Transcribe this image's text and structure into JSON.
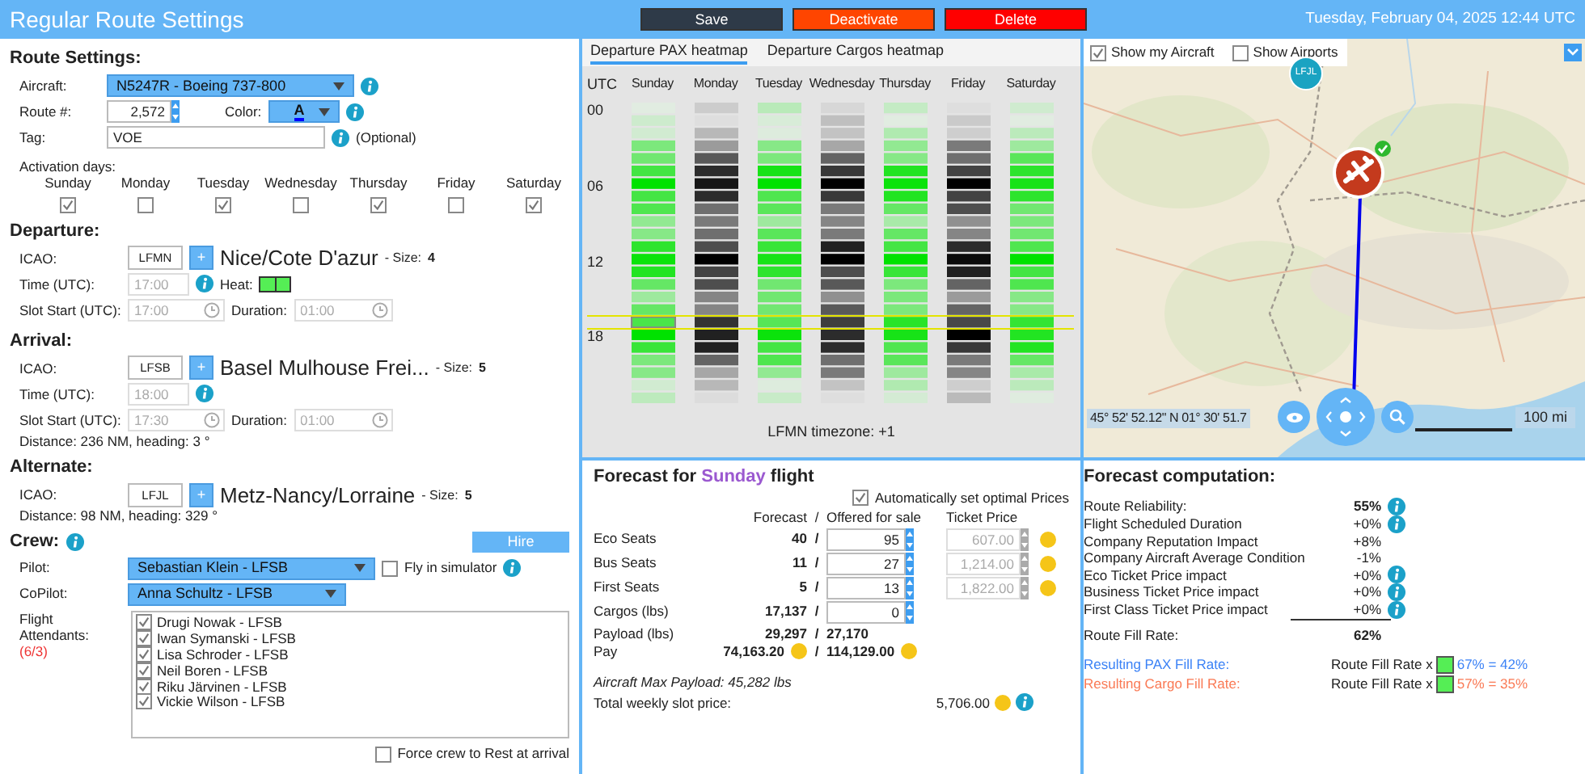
{
  "header": {
    "title": "Regular Route Settings",
    "buttons": [
      {
        "label": "Save",
        "kind": "save"
      },
      {
        "label": "Deactivate",
        "kind": "deactivate"
      },
      {
        "label": "Delete",
        "kind": "delete"
      }
    ],
    "datetime": "Tuesday, February 04, 2025 12:44 UTC"
  },
  "route_settings": {
    "heading": "Route Settings:",
    "aircraft": {
      "label": "Aircraft:",
      "value": "N5247R - Boeing 737-800"
    },
    "route_number": {
      "label": "Route #:",
      "value": "2,572"
    },
    "color": {
      "label": "Color:",
      "value": "A"
    },
    "tag": {
      "label": "Tag:",
      "value": "VOE",
      "note": "(Optional)"
    },
    "activation_days": {
      "label": "Activation days:",
      "days": [
        {
          "label": "Sunday",
          "checked": true
        },
        {
          "label": "Monday",
          "checked": false
        },
        {
          "label": "Tuesday",
          "checked": true
        },
        {
          "label": "Wednesday",
          "checked": false
        },
        {
          "label": "Thursday",
          "checked": true
        },
        {
          "label": "Friday",
          "checked": false
        },
        {
          "label": "Saturday",
          "checked": true
        }
      ]
    }
  },
  "departure": {
    "heading": "Departure:",
    "icao_label": "ICAO:",
    "icao": "LFMN",
    "add": "+",
    "airport": "Nice/Cote D'azur",
    "size_label": "- Size:",
    "size": "4",
    "time_label": "Time (UTC):",
    "time": "17:00",
    "heat_label": "Heat:",
    "slot_label": "Slot Start (UTC):",
    "slot": "17:00",
    "duration_label": "Duration:",
    "duration": "01:00"
  },
  "arrival": {
    "heading": "Arrival:",
    "icao_label": "ICAO:",
    "icao": "LFSB",
    "add": "+",
    "airport": "Basel Mulhouse Frei...",
    "size_label": "- Size:",
    "size": "5",
    "time_label": "Time (UTC):",
    "time": "18:00",
    "slot_label": "Slot Start (UTC):",
    "slot": "17:30",
    "duration_label": "Duration:",
    "duration": "01:00",
    "distance": "Distance: 236 NM, heading: 3 °"
  },
  "alternate": {
    "heading": "Alternate:",
    "icao_label": "ICAO:",
    "icao": "LFJL",
    "add": "+",
    "airport": "Metz-Nancy/Lorraine",
    "size_label": "- Size:",
    "size": "5",
    "distance": "Distance: 98 NM, heading: 329 °"
  },
  "crew": {
    "heading": "Crew:",
    "hire": "Hire",
    "pilot_label": "Pilot:",
    "pilot": "Sebastian Klein - LFSB",
    "simulator": {
      "label": "Fly in simulator",
      "checked": false
    },
    "copilot_label": "CoPilot:",
    "copilot": "Anna Schultz - LFSB",
    "attendants_label": "Flight Attendants:",
    "attendants_count": "(6/3)",
    "attendants": [
      {
        "name": "Drugi Nowak - LFSB",
        "checked": true
      },
      {
        "name": "Iwan Symanski - LFSB",
        "checked": true
      },
      {
        "name": "Lisa Schroder - LFSB",
        "checked": true
      },
      {
        "name": "Neil Boren - LFSB",
        "checked": true
      },
      {
        "name": "Riku Järvinen - LFSB",
        "checked": true
      },
      {
        "name": "Vickie Wilson - LFSB",
        "checked": true
      }
    ],
    "force_rest": {
      "label": "Force crew to Rest at arrival",
      "checked": false
    }
  },
  "heatmap": {
    "tabs": [
      {
        "label": "Departure PAX heatmap",
        "selected": true
      },
      {
        "label": "Departure Cargos heatmap",
        "selected": false
      }
    ],
    "utc": "UTC",
    "hours": [
      "00",
      "06",
      "12",
      "18"
    ],
    "days": [
      "Sunday",
      "Monday",
      "Tuesday",
      "Wednesday",
      "Thursday",
      "Friday",
      "Saturday"
    ],
    "timezone": "LFMN timezone: +1"
  },
  "map": {
    "show_aircraft": {
      "label": "Show my Aircraft",
      "checked": true
    },
    "show_airports": {
      "label": "Show Airports",
      "checked": false
    },
    "marker": "LFJL",
    "coordinates": "45° 52' 52.12\" N 01° 30' 51.7",
    "scale": "100 mi"
  },
  "forecast": {
    "title_before": "Forecast for",
    "day": "Sunday",
    "title_after": "flight",
    "auto_prices": {
      "label": "Automatically set optimal Prices",
      "checked": true
    },
    "columns": [
      "Forecast",
      "/",
      "Offered for sale",
      "Ticket Price"
    ],
    "rows": [
      {
        "label": "Eco Seats",
        "forecast": "40",
        "slash": "/",
        "offered": "95",
        "price": "607.00"
      },
      {
        "label": "Bus Seats",
        "forecast": "11",
        "slash": "/",
        "offered": "27",
        "price": "1,214.00"
      },
      {
        "label": "First Seats",
        "forecast": "5",
        "slash": "/",
        "offered": "13",
        "price": "1,822.00"
      },
      {
        "label": "Cargos (lbs)",
        "forecast": "17,137",
        "slash": "/",
        "offered": "0"
      }
    ],
    "payload": {
      "label": "Payload (lbs)",
      "forecast": "29,297",
      "slash": "/",
      "offered": "27,170"
    },
    "pay": {
      "label": "Pay",
      "forecast": "74,163.20",
      "slash": "/",
      "offered": "114,129.00"
    },
    "max_payload": "Aircraft Max Payload: 45,282 lbs",
    "slot_price_label": "Total weekly slot price:",
    "slot_price": "5,706.00"
  },
  "computation": {
    "title": "Forecast computation:",
    "rows": [
      {
        "label": "Route Reliability:",
        "value": "55%",
        "bold": true,
        "info": true
      },
      {
        "label": "Flight Scheduled Duration",
        "value": "+0%",
        "bold": false,
        "info": true
      },
      {
        "label": "Company Reputation Impact",
        "value": "+8%",
        "bold": false,
        "info": false
      },
      {
        "label": "Company Aircraft Average Condition",
        "value": "-1%",
        "bold": false,
        "info": false
      },
      {
        "label": "Eco Ticket Price impact",
        "value": "+0%",
        "bold": false,
        "info": true
      },
      {
        "label": "Business Ticket Price impact",
        "value": "+0%",
        "bold": false,
        "info": true
      },
      {
        "label": "First Class Ticket Price impact",
        "value": "+0%",
        "bold": false,
        "info": true
      }
    ],
    "total": {
      "label": "Route Fill Rate:",
      "value": "62%"
    },
    "results": [
      {
        "label": "Resulting PAX Fill Rate:",
        "formula": "Route Fill Rate x",
        "rate": "67% = 42%",
        "color": "#3b82f6"
      },
      {
        "label": "Resulting Cargo Fill Rate:",
        "formula": "Route Fill Rate x",
        "rate": "57% = 35%",
        "color": "#fa7a55"
      }
    ]
  }
}
